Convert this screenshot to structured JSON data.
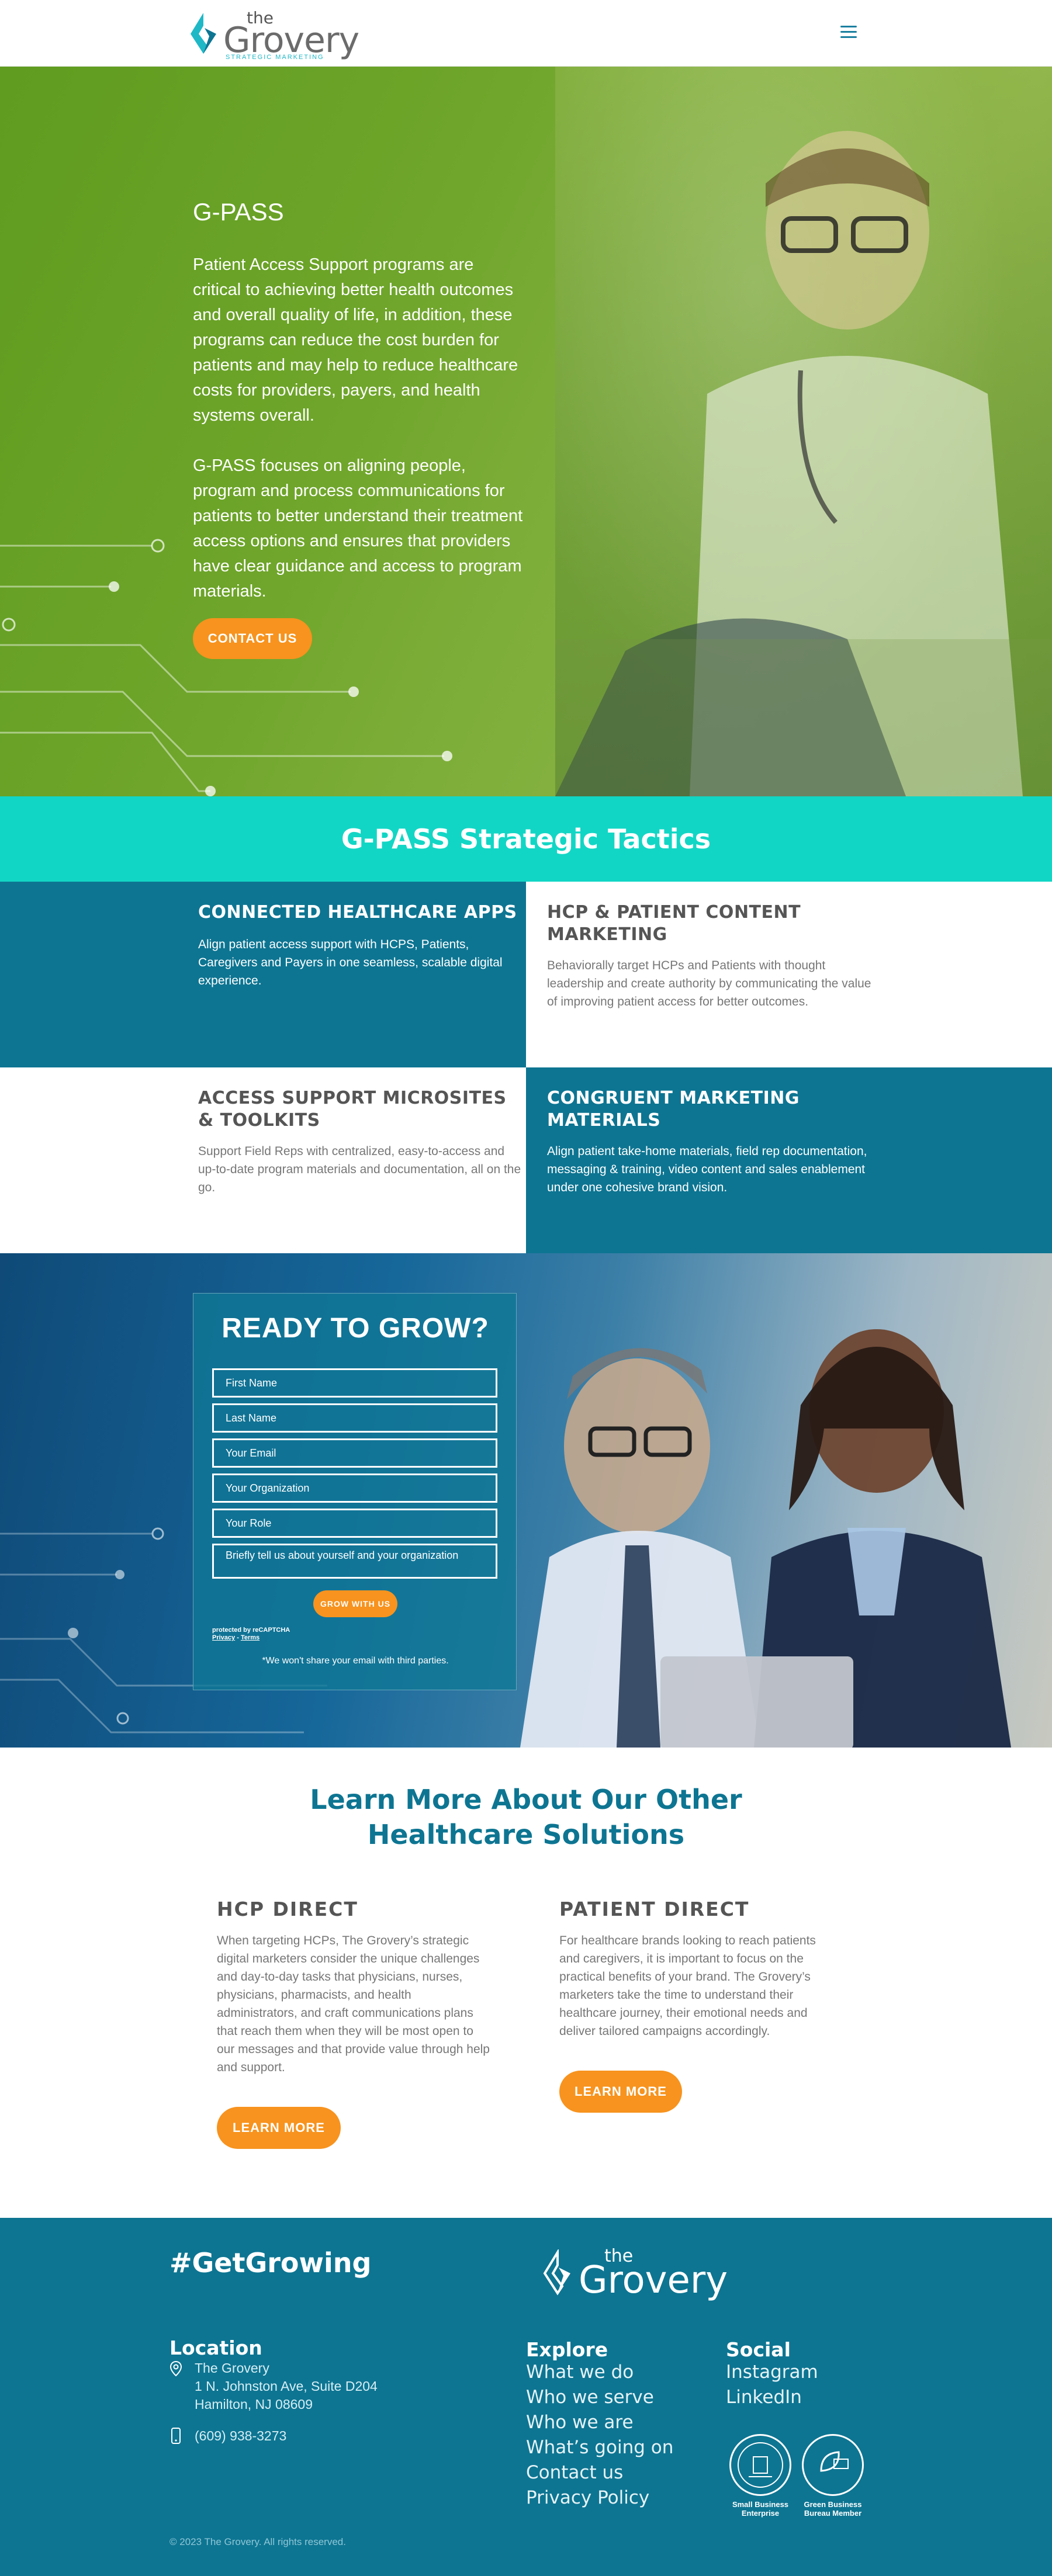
{
  "header": {
    "logo_the": "the",
    "logo_word": "Grovery",
    "logo_tagline": "STRATEGIC MARKETING"
  },
  "hero": {
    "title": "G-PASS",
    "paragraph1": "Patient Access Support programs are critical to achieving better health outcomes and overall quality of life, in addition, these programs can reduce the cost burden for patients and may help to reduce healthcare costs for providers, payers, and health systems overall.",
    "paragraph2": "G-PASS focuses on aligning people, program and process communications for patients to better understand their treatment access options and ensures that providers have clear guidance and access to program materials.",
    "cta": "CONTACT US"
  },
  "tactics": {
    "title": "G-PASS Strategic Tactics",
    "items": [
      {
        "title": "CONNECTED HEALTHCARE APPS",
        "text": "Align patient access support with HCPS, Patients, Caregivers and Payers in one seamless, scalable digital experience."
      },
      {
        "title": "HCP & PATIENT CONTENT MARKETING",
        "text": "Behaviorally target HCPs and Patients with thought leadership and create authority by communicating the value of improving patient access for better outcomes."
      },
      {
        "title": "ACCESS SUPPORT MICROSITES & TOOLKITS",
        "text": "Support Field Reps with centralized, easy-to-access and up-to-date program materials and documentation, all on the go."
      },
      {
        "title": "CONGRUENT MARKETING MATERIALS",
        "text": "Align patient take-home materials, field rep documentation, messaging & training, video content and sales enablement under one cohesive brand vision."
      }
    ]
  },
  "grow": {
    "title": "READY TO GROW?",
    "fields": {
      "first_name": "First Name",
      "last_name": "Last Name",
      "email": "Your Email",
      "organization": "Your Organization",
      "role": "Your Role",
      "message": "Briefly tell us about yourself and your organization"
    },
    "submit": "GROW WITH US",
    "recaptcha_line1": "protected by reCAPTCHA",
    "recaptcha_privacy": "Privacy",
    "recaptcha_sep": " - ",
    "recaptcha_terms": "Terms",
    "note": "*We won't share your email with third parties."
  },
  "learn": {
    "title_line1": "Learn More About Our Other",
    "title_line2": "Healthcare Solutions",
    "hcp": {
      "title": "HCP DIRECT",
      "text": "When targeting HCPs, The Grovery’s strategic digital marketers consider the unique challenges and day-to-day tasks that physicians, nurses, physicians, pharmacists, and health administrators, and craft communications plans that reach them when they will be most open to our messages and that provide value through help and support.",
      "cta": "LEARN MORE"
    },
    "patient": {
      "title": "PATIENT DIRECT",
      "text": "For healthcare brands looking to reach patients and caregivers, it is important to focus on the practical benefits of your brand. The Grovery’s marketers take the time to understand their healthcare journey, their emotional needs and deliver tailored campaigns accordingly.",
      "cta": "LEARN MORE"
    }
  },
  "footer": {
    "hashtag": "#GetGrowing",
    "logo_the": "the",
    "logo_word": "Grovery",
    "location_head": "Location",
    "company": "The Grovery",
    "address1": "1 N. Johnston Ave, Suite D204",
    "address2": "Hamilton, NJ 08609",
    "phone": "(609) 938-3273",
    "explore_head": "Explore",
    "explore": [
      "What we do",
      "Who we serve",
      "Who we are",
      "What’s going on",
      "Contact us",
      "Privacy Policy"
    ],
    "social_head": "Social",
    "social": [
      "Instagram",
      "LinkedIn"
    ],
    "badge1_line1": "Small Business",
    "badge1_line2": "Enterprise",
    "badge2_line1": "Green Business",
    "badge2_line2": "Bureau Member",
    "copyright": "© 2023 The Grovery. All rights reserved."
  },
  "colors": {
    "brand_teal": "#0d7592",
    "accent_aqua": "#12d6c5",
    "cta_orange": "#f7931e",
    "hero_green": "#6ea52a"
  }
}
